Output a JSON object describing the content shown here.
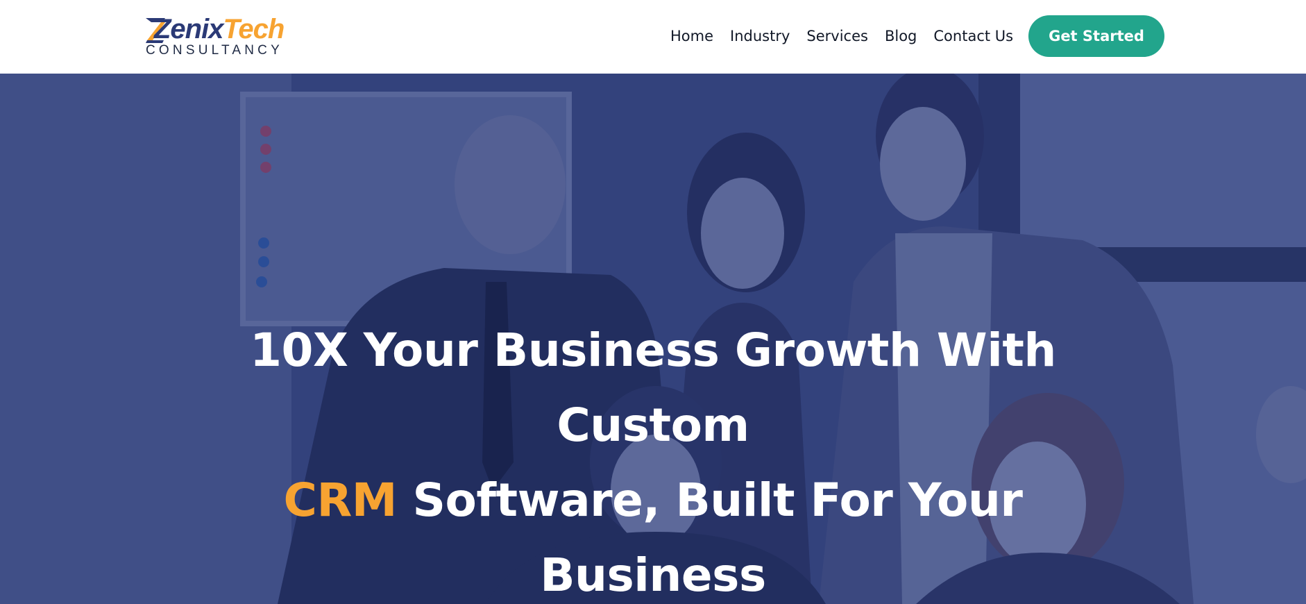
{
  "brand": {
    "name_part1": "Zenix",
    "name_part2": "Tech",
    "tagline": "CONSULTANCY",
    "colors": {
      "primary": "#2b3a76",
      "accent": "#f7a331"
    }
  },
  "nav": {
    "items": [
      {
        "label": "Home"
      },
      {
        "label": "Industry"
      },
      {
        "label": "Services"
      },
      {
        "label": "Blog"
      },
      {
        "label": "Contact Us"
      }
    ]
  },
  "cta": {
    "label": "Get Started",
    "color": "#22a58c"
  },
  "hero": {
    "line1": "10X Your Business Growth With",
    "line2": "Custom",
    "line3_accent": "CRM",
    "line3_rest": " Software, Built For Your",
    "line4": "Business",
    "accent_color": "#f7a331"
  }
}
